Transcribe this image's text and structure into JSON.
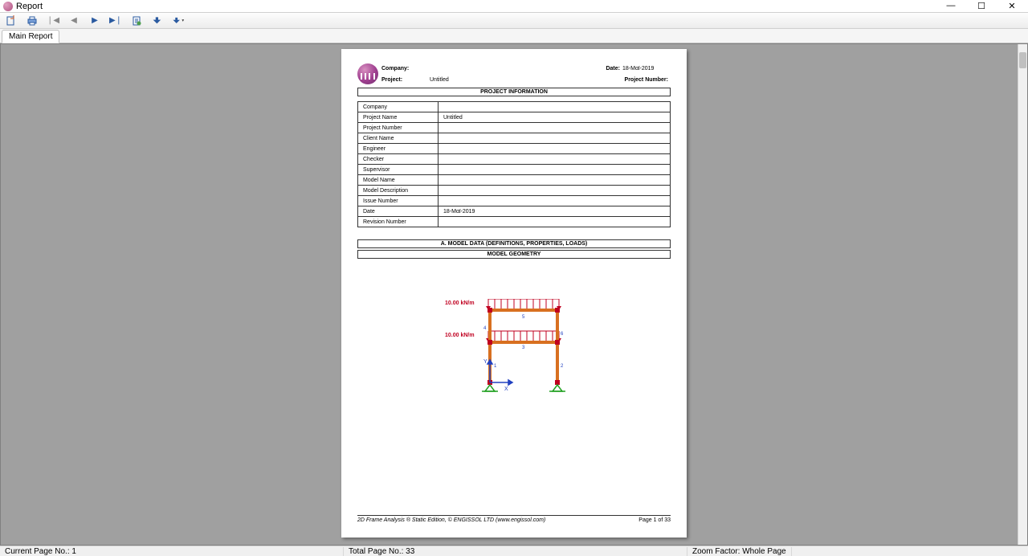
{
  "window": {
    "title": "Report"
  },
  "tabs": {
    "main": "Main Report"
  },
  "header": {
    "company_lbl": "Company:",
    "company_val": "",
    "date_lbl": "Date:",
    "date_val": "18-Μαϊ-2019",
    "project_lbl": "Project:",
    "project_val": "Untitled",
    "projnum_lbl": "Project Number:",
    "projnum_val": ""
  },
  "sections": {
    "proj_info": "PROJECT INFORMATION",
    "model_data": "A. MODEL DATA (DEFINITIONS, PROPERTIES, LOADS)",
    "model_geom": "MODEL GEOMETRY"
  },
  "info_rows": [
    {
      "label": "Company",
      "value": ""
    },
    {
      "label": "Project Name",
      "value": "Untitled"
    },
    {
      "label": "Project Number",
      "value": ""
    },
    {
      "label": "Client Name",
      "value": ""
    },
    {
      "label": "Engineer",
      "value": ""
    },
    {
      "label": "Checker",
      "value": ""
    },
    {
      "label": "Supervisor",
      "value": ""
    },
    {
      "label": "Model Name",
      "value": ""
    },
    {
      "label": "Model Description",
      "value": ""
    },
    {
      "label": "Issue Number",
      "value": ""
    },
    {
      "label": "Date",
      "value": "18-Μαϊ-2019"
    },
    {
      "label": "Revision Number",
      "value": ""
    }
  ],
  "diagram": {
    "load1": "10.00 kN/m",
    "load2": "10.00 kN/m",
    "axis_x": "X",
    "axis_y": "Y",
    "members": {
      "m1": "1",
      "m2": "2",
      "m3": "3",
      "m4": "4",
      "m5": "5",
      "m6": "6"
    }
  },
  "footer": {
    "left": "2D Frame Analysis ® Static Edition, © ENGISSOL LTD (www.engissol.com)",
    "right": "Page 1 of 33"
  },
  "status": {
    "current": "Current Page No.: 1",
    "total": "Total Page No.: 33",
    "zoom": "Zoom Factor: Whole Page"
  }
}
